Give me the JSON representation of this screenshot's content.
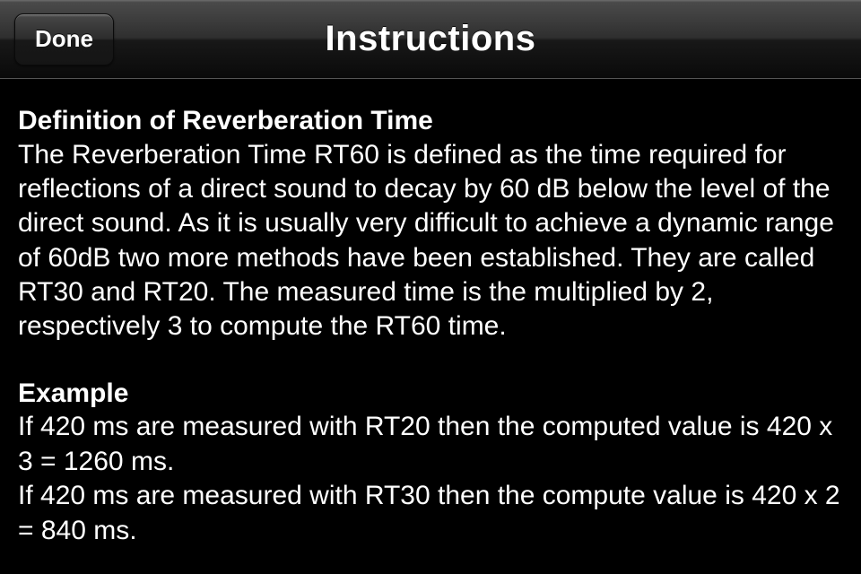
{
  "navbar": {
    "title": "Instructions",
    "done_label": "Done"
  },
  "content": {
    "definition_heading": "Definition of Reverberation Time",
    "definition_body": "The Reverberation Time RT60 is defined as the time required for reflections of a direct sound to decay by 60 dB below the level of the direct sound. As it is usually very difficult to achieve a dynamic range of 60dB two more methods have been established. They are called RT30 and RT20. The measured time is the multiplied by 2, respectively 3 to compute the RT60 time.",
    "example_heading": "Example",
    "example_line1": "If 420 ms are measured with RT20 then the computed value is 420 x 3 = 1260 ms.",
    "example_line2": "If 420 ms are measured with RT30 then the compute value is 420 x 2 = 840 ms."
  }
}
